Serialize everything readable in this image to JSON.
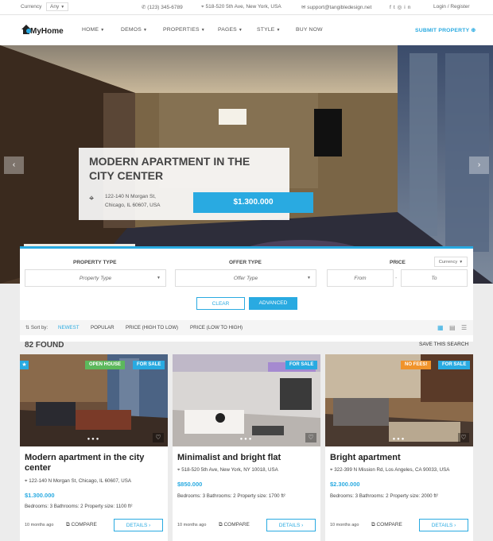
{
  "topbar": {
    "currency_label": "Currency",
    "currency_value": "Any",
    "phone": "(123) 345-6789",
    "address": "518-520 5th Ave, New York, USA",
    "email": "support@tangibledesign.net",
    "login": "Login / Register"
  },
  "brand": {
    "name": "MyHome"
  },
  "nav": {
    "items": [
      {
        "label": "HOME"
      },
      {
        "label": "DEMOS"
      },
      {
        "label": "PROPERTIES"
      },
      {
        "label": "PAGES"
      },
      {
        "label": "STYLE"
      },
      {
        "label": "BUY NOW"
      }
    ],
    "submit": "SUBMIT PROPERTY"
  },
  "hero": {
    "title": "MODERN APARTMENT IN THE CITY CENTER",
    "address_line1": "122-140 N Morgan St,",
    "address_line2": "Chicago, IL 60607, USA",
    "price": "$1.300.000"
  },
  "search": {
    "property_type_label": "PROPERTY TYPE",
    "property_type_placeholder": "Property Type",
    "offer_type_label": "OFFER TYPE",
    "offer_type_placeholder": "Offer Type",
    "price_label": "PRICE",
    "currency_select": "Currency",
    "from": "From",
    "dash": "-",
    "to": "To",
    "clear": "CLEAR",
    "advanced": "ADVANCED"
  },
  "sortbar": {
    "label": "Sort by:",
    "options": [
      "NEWEST",
      "POPULAR",
      "PRICE (HIGH TO LOW)",
      "PRICE (LOW TO HIGH)"
    ]
  },
  "results": {
    "found": "82 FOUND",
    "save": "SAVE THIS SEARCH"
  },
  "listings": [
    {
      "title": "Modern apartment in the city center",
      "address": "122-140 N Morgan St, Chicago, IL 60607, USA",
      "price": "$1.300.000",
      "specs": "Bedrooms: 3   Bathrooms: 2   Property size: 1100 ft²",
      "ago": "10 months ago",
      "compare": "COMPARE",
      "details": "DETAILS ›",
      "tags": [
        "OPEN HOUSE",
        "FOR SALE"
      ],
      "tag_colors": [
        "#5cb85c",
        "#29aae1"
      ]
    },
    {
      "title": "Minimalist and bright flat",
      "address": "518-520 5th Ave, New York, NY 10018, USA",
      "price": "$850.000",
      "specs": "Bedrooms: 3   Bathrooms: 2   Property size: 1700 ft²",
      "ago": "10 months ago",
      "compare": "COMPARE",
      "details": "DETAILS ›",
      "tags": [
        "FOR SALE"
      ],
      "tag_colors": [
        "#29aae1"
      ]
    },
    {
      "title": "Bright apartment",
      "address": "322-399 N Mission Rd, Los Angeles, CA 90033, USA",
      "price": "$2.300.000",
      "specs": "Bedrooms: 3   Bathrooms: 2   Property size: 2000 ft²",
      "ago": "10 months ago",
      "compare": "COMPARE",
      "details": "DETAILS ›",
      "tags": [
        "NO FEES!",
        "FOR SALE"
      ],
      "tag_colors": [
        "#f0932b",
        "#29aae1"
      ]
    }
  ],
  "colors": {
    "accent": "#29aae1"
  }
}
